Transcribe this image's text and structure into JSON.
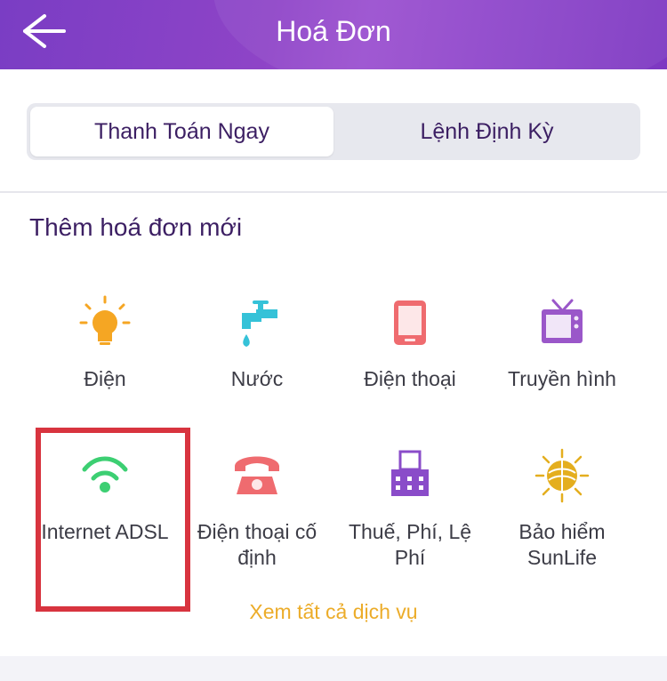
{
  "header": {
    "title": "Hoá Đơn",
    "back_icon": "arrow-left-icon"
  },
  "tabs": [
    {
      "label": "Thanh Toán Ngay",
      "active": true
    },
    {
      "label": "Lệnh Định Kỳ",
      "active": false
    }
  ],
  "section_title": "Thêm hoá đơn mới",
  "services": [
    {
      "label": "Điện",
      "icon": "lightbulb-icon",
      "color": "#f5a623"
    },
    {
      "label": "Nước",
      "icon": "water-tap-icon",
      "color": "#35c2d8"
    },
    {
      "label": "Điện thoại",
      "icon": "mobile-phone-icon",
      "color": "#ef6b6f"
    },
    {
      "label": "Truyền hình",
      "icon": "tv-icon",
      "color": "#9a57c9"
    },
    {
      "label": "Internet ADSL",
      "icon": "wifi-icon",
      "color": "#3ccf72",
      "highlighted": true
    },
    {
      "label": "Điện thoại cố định",
      "icon": "landline-phone-icon",
      "color": "#ef6b6f"
    },
    {
      "label": "Thuế, Phí, Lệ Phí",
      "icon": "building-icon",
      "color": "#8a4cc9"
    },
    {
      "label": "Bảo hiểm SunLife",
      "icon": "sunlife-logo-icon",
      "color": "#e4ae1e"
    }
  ],
  "see_all": "Xem tất cả dịch vụ"
}
